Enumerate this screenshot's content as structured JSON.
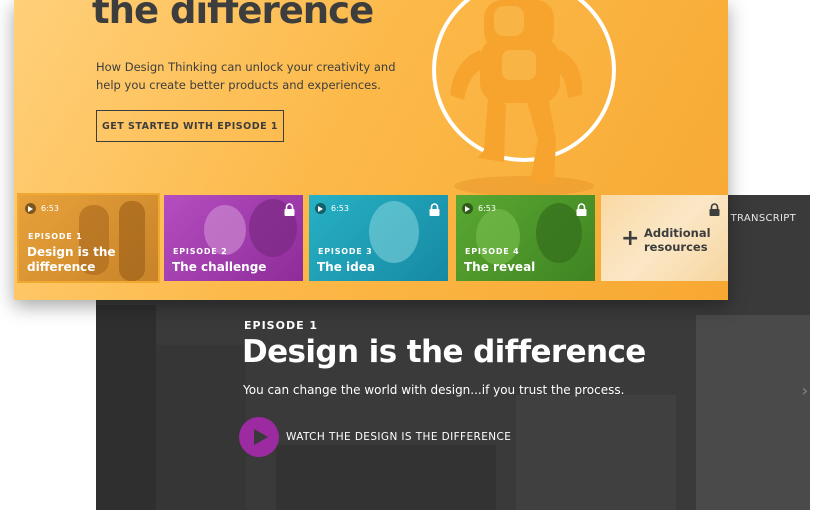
{
  "hero": {
    "heading": "the difference",
    "subtitle_line1": "How Design Thinking can unlock your creativity and",
    "subtitle_line2": "help you create better products and experiences.",
    "cta_label": "GET STARTED WITH EPISODE 1"
  },
  "episodes": [
    {
      "number": "EPISODE 1",
      "title_line1": "Design is the",
      "title_line2": "difference",
      "duration": "6:53",
      "locked": false,
      "color": "#f0a830"
    },
    {
      "number": "EPISODE 2",
      "title_line1": "The challenge",
      "title_line2": "",
      "locked": true,
      "color": "#a93bb4"
    },
    {
      "number": "EPISODE 3",
      "title_line1": "The idea",
      "title_line2": "",
      "duration": "6:53",
      "locked": true,
      "color": "#1ea3b8"
    },
    {
      "number": "EPISODE 4",
      "title_line1": "The reveal",
      "title_line2": "",
      "duration": "6:53",
      "locked": true,
      "color": "#4f9a2a"
    }
  ],
  "resources": {
    "label_line1": "Additional",
    "label_line2": "resources",
    "locked": true
  },
  "detail": {
    "transcript_link": "O TRANSCRIPT",
    "episode_label": "EPISODE 1",
    "title": "Design is the difference",
    "subtitle": "You can change the world with design...if you trust the process.",
    "watch_label": "WATCH THE DESIGN IS THE DIFFERENCE",
    "accent_color": "#9c2aa0"
  }
}
